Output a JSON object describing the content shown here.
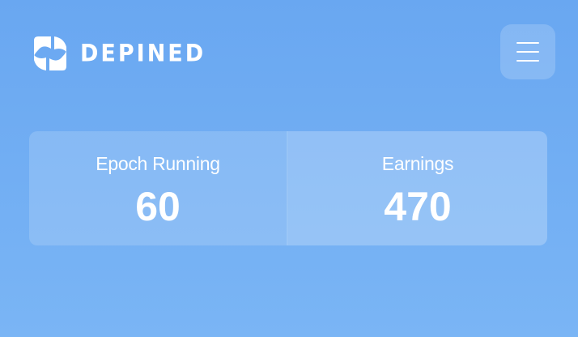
{
  "header": {
    "brand_name": "DEPINED",
    "logo_icon": "depined-logo-icon",
    "menu_icon": "hamburger-menu-icon"
  },
  "stats": [
    {
      "label": "Epoch Running",
      "value": "60"
    },
    {
      "label": "Earnings",
      "value": "470"
    }
  ],
  "colors": {
    "background_top": "#69a7f1",
    "background_bottom": "#7ab5f5",
    "text": "#ffffff"
  }
}
